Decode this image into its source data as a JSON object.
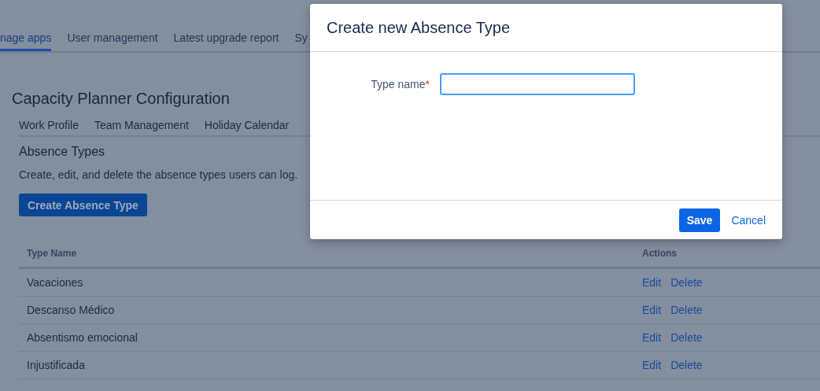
{
  "top_tabs": [
    {
      "label": "nage apps",
      "selected": true
    },
    {
      "label": "User management",
      "selected": false
    },
    {
      "label": "Latest upgrade report",
      "selected": false
    },
    {
      "label": "Sy",
      "selected": false
    }
  ],
  "page_title": "Capacity Planner Configuration",
  "config_tabs": [
    "Work Profile",
    "Team Management",
    "Holiday Calendar"
  ],
  "section": {
    "title": "Absence Types",
    "description": "Create, edit, and delete the absence types users can log.",
    "button": "Create Absence Type"
  },
  "table": {
    "columns": [
      "Type Name",
      "Actions"
    ],
    "rows": [
      {
        "name": "Vacaciones",
        "actions": [
          "Edit",
          "Delete"
        ]
      },
      {
        "name": "Descanso Médico",
        "actions": [
          "Edit",
          "Delete"
        ]
      },
      {
        "name": "Absentismo emocional",
        "actions": [
          "Edit",
          "Delete"
        ]
      },
      {
        "name": "Injustificada",
        "actions": [
          "Edit",
          "Delete"
        ]
      }
    ]
  },
  "dialog": {
    "title": "Create new Absence Type",
    "field": {
      "label": "Type name",
      "required_mark": "*"
    },
    "buttons": [
      {
        "label": "Save",
        "kind": "primary"
      },
      {
        "label": "Cancel",
        "kind": "link"
      }
    ]
  }
}
